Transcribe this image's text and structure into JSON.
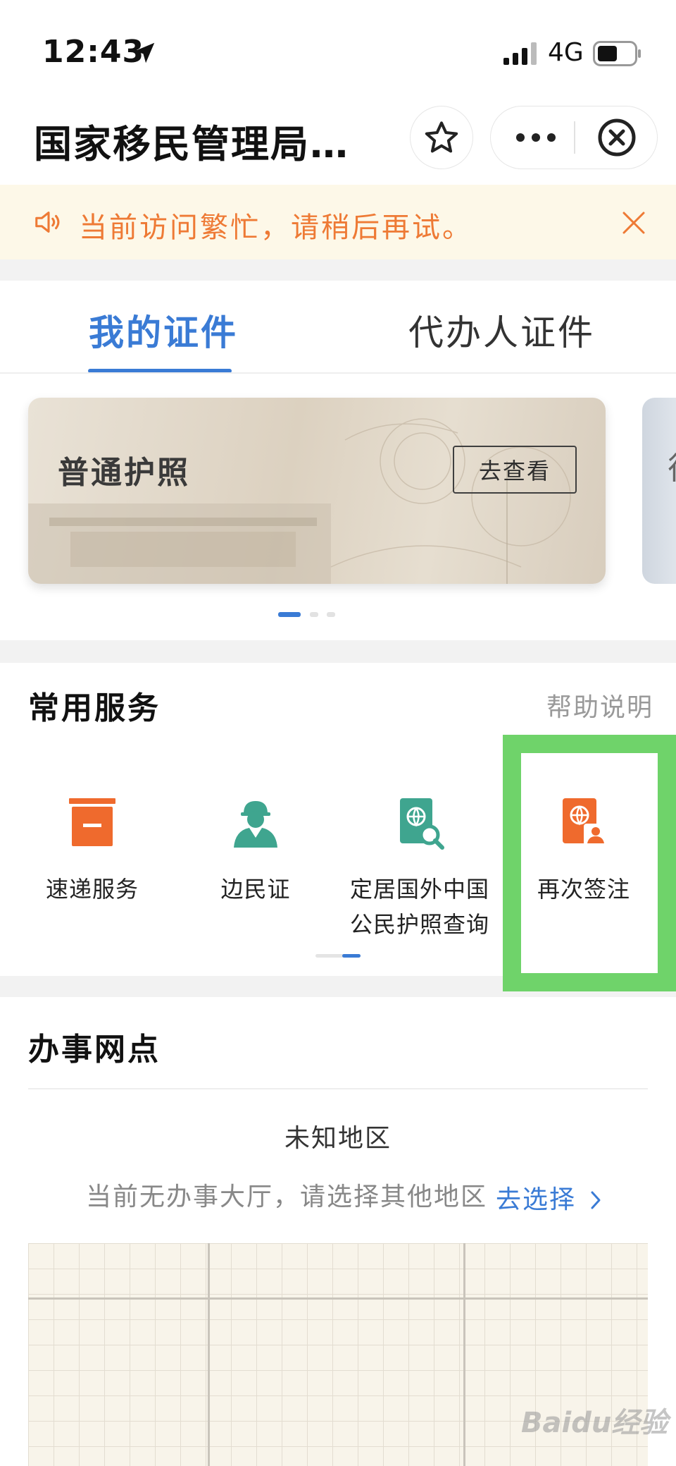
{
  "status_bar": {
    "time": "12:43",
    "network": "4G"
  },
  "nav": {
    "title": "国家移民管理局…"
  },
  "notice": {
    "text": "当前访问繁忙，请稍后再试。"
  },
  "tabs": [
    {
      "label": "我的证件",
      "active": true
    },
    {
      "label": "代办人证件",
      "active": false
    }
  ],
  "cards": {
    "current": {
      "title": "普通护照",
      "button": "去查看"
    },
    "next_peek_glyph": "往",
    "page_count": 3,
    "active_index": 0
  },
  "services": {
    "title": "常用服务",
    "help": "帮助说明",
    "items": [
      {
        "label": "速递服务",
        "icon": "express-box-icon",
        "color": "#ef6a2d"
      },
      {
        "label": "边民证",
        "icon": "border-resident-icon",
        "color": "#3fa58f"
      },
      {
        "label_line1": "定居国外中国",
        "label_line2": "公民护照查询",
        "icon": "passport-search-icon",
        "color": "#3fa58f"
      },
      {
        "label": "再次签注",
        "icon": "re-endorsement-icon",
        "color": "#ef6a2d",
        "highlighted": true
      }
    ]
  },
  "offices": {
    "title": "办事网点",
    "region": "未知地区",
    "empty_message": "当前无办事大厅，请选择其他地区",
    "choose_link": "去选择"
  },
  "watermark": "Baidu经验",
  "colors": {
    "accent": "#3a7bd5",
    "notice_text": "#ee7a35",
    "notice_bg": "#fdf8e8",
    "highlight": "#6fd36a"
  }
}
